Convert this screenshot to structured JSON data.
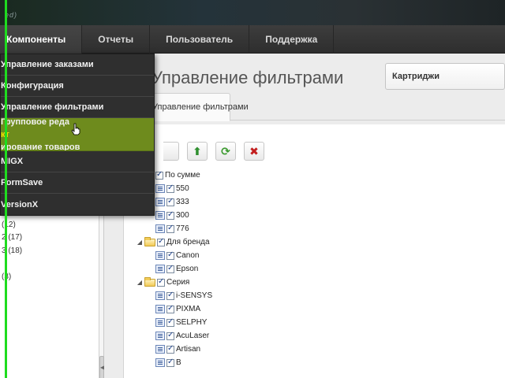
{
  "banner": {
    "glimpse": "ed)"
  },
  "menu": [
    {
      "label": "Компоненты",
      "active": true
    },
    {
      "label": "Отчеты",
      "active": false
    },
    {
      "label": "Пользователь",
      "active": false
    },
    {
      "label": "Поддержка",
      "active": false
    }
  ],
  "dropdown": {
    "items": [
      {
        "label": "Управление заказами"
      },
      {
        "label": "Конфигурация"
      },
      {
        "label": "Управление фильтрами"
      },
      {
        "label_parts": [
          "Групповое реда",
          "кт",
          "ирование товаров"
        ]
      },
      {
        "label": "MIGX"
      },
      {
        "label": "FormSave"
      },
      {
        "label": "VersionX"
      }
    ]
  },
  "left_panel": {
    "counts": [
      "(12)",
      "2 (17)",
      "3 (18)",
      "(3)"
    ]
  },
  "main": {
    "page_title": "Управление фильтрами",
    "select_value": "Картриджи",
    "tab_label": "Управление фильтрами"
  },
  "toolbar": {
    "icons": [
      "up-arrow-icon",
      "refresh-icon",
      "delete-icon"
    ]
  },
  "tree": {
    "groups": [
      {
        "label": "По сумме",
        "items": [
          "550",
          "333",
          "300",
          "776"
        ]
      },
      {
        "label": "Для бренда",
        "items": [
          "Canon",
          "Epson"
        ]
      },
      {
        "label": "Серия",
        "items": [
          "i-SENSYS",
          "PIXMA",
          "SELPHY",
          "AcuLaser",
          "Artisan",
          "B"
        ]
      }
    ]
  },
  "colors": {
    "menu_bg": "#2e2e2e",
    "dropdown_bg": "#2f2f2f",
    "highlight": "#6e8b1d",
    "up_arrow": "#2f8f2f",
    "refresh": "#3b9a2f",
    "delete": "#c21d1d",
    "guide_line": "#1fdc1f"
  }
}
